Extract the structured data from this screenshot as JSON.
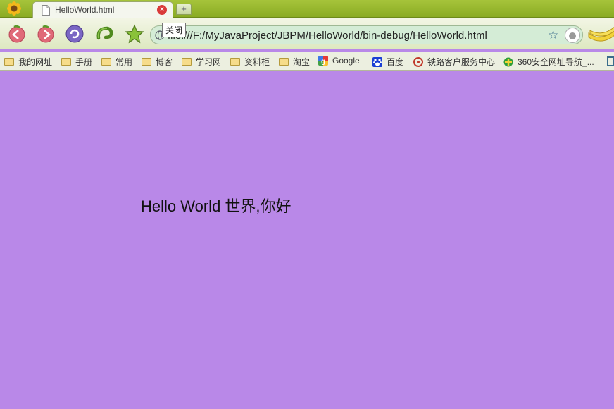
{
  "tab": {
    "title": "HelloWorld.html",
    "close_label": "×",
    "new_tab_label": "+"
  },
  "tooltip": {
    "text": "关闭"
  },
  "address": {
    "url": "file:///F:/MyJavaProject/JBPM/HelloWorld/bin-debug/HelloWorld.html"
  },
  "bookmarks": [
    {
      "label": "我的网址",
      "icon": "folder-icon"
    },
    {
      "label": "手册",
      "icon": "folder-icon"
    },
    {
      "label": "常用",
      "icon": "folder-icon"
    },
    {
      "label": "博客",
      "icon": "folder-icon"
    },
    {
      "label": "学习网",
      "icon": "folder-icon"
    },
    {
      "label": "资料柜",
      "icon": "folder-icon"
    },
    {
      "label": "淘宝",
      "icon": "folder-icon"
    },
    {
      "label": "Google",
      "icon": "google-icon"
    },
    {
      "label": "百度",
      "icon": "baidu-icon"
    },
    {
      "label": "铁路客户服务中心",
      "icon": "railway-icon"
    },
    {
      "label": "360安全网址导航_...",
      "icon": "360-icon"
    }
  ],
  "page": {
    "text": "Hello World 世界,你好"
  },
  "colors": {
    "page_background": "#b988e8",
    "chrome_green": "#8aab24"
  }
}
